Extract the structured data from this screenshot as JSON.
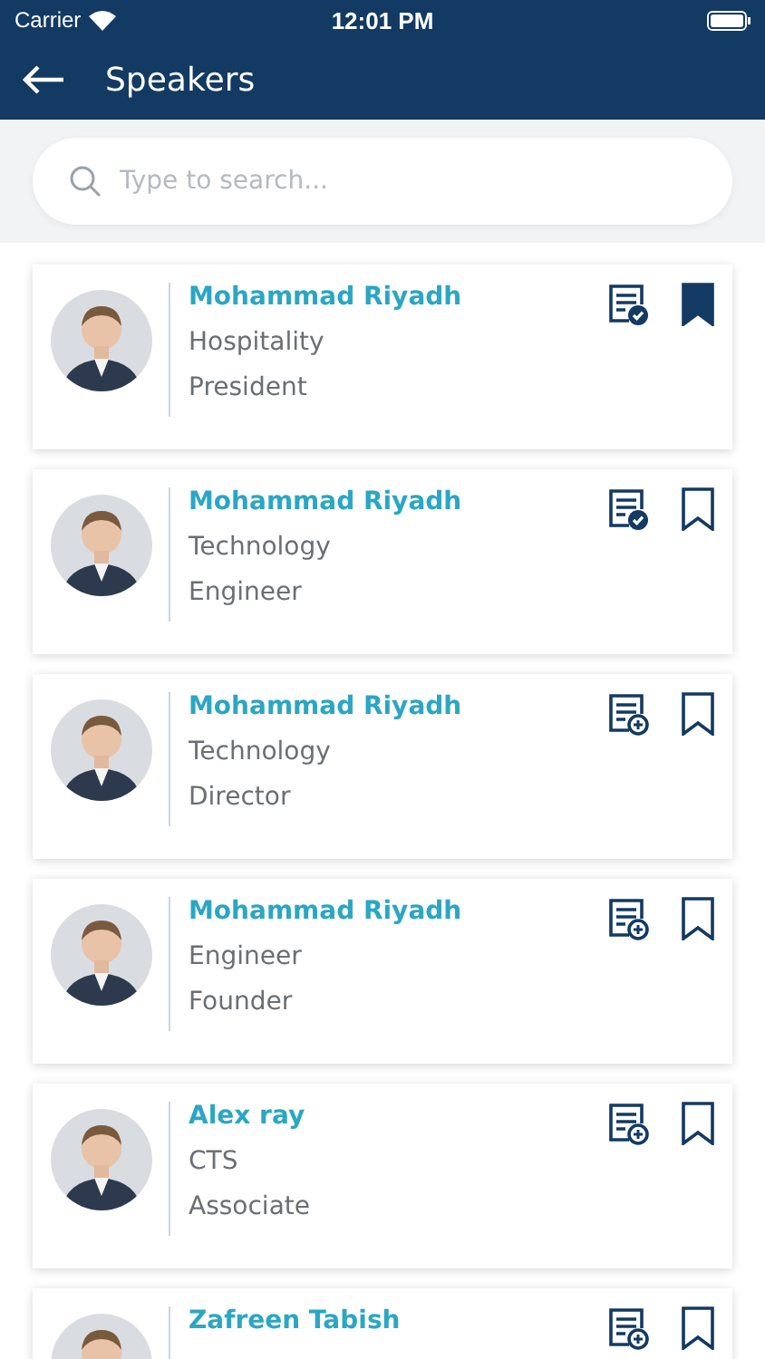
{
  "status_bar": {
    "carrier": "Carrier",
    "time": "12:01 PM"
  },
  "nav": {
    "title": "Speakers"
  },
  "search": {
    "placeholder": "Type to search..."
  },
  "speakers": [
    {
      "name": "Mohammad Riyadh",
      "line_1": "Hospitality",
      "line_2": "President",
      "in_agenda": true,
      "bookmarked": true
    },
    {
      "name": "Mohammad Riyadh",
      "line_1": "Technology",
      "line_2": "Engineer",
      "in_agenda": true,
      "bookmarked": false
    },
    {
      "name": "Mohammad Riyadh",
      "line_1": "Technology",
      "line_2": "Director",
      "in_agenda": false,
      "bookmarked": false
    },
    {
      "name": "Mohammad Riyadh",
      "line_1": "Engineer",
      "line_2": "Founder",
      "in_agenda": false,
      "bookmarked": false
    },
    {
      "name": "Alex ray",
      "line_1": "CTS",
      "line_2": "Associate",
      "in_agenda": false,
      "bookmarked": false
    },
    {
      "name": "Zafreen Tabish",
      "in_agenda": false,
      "bookmarked": false
    }
  ]
}
